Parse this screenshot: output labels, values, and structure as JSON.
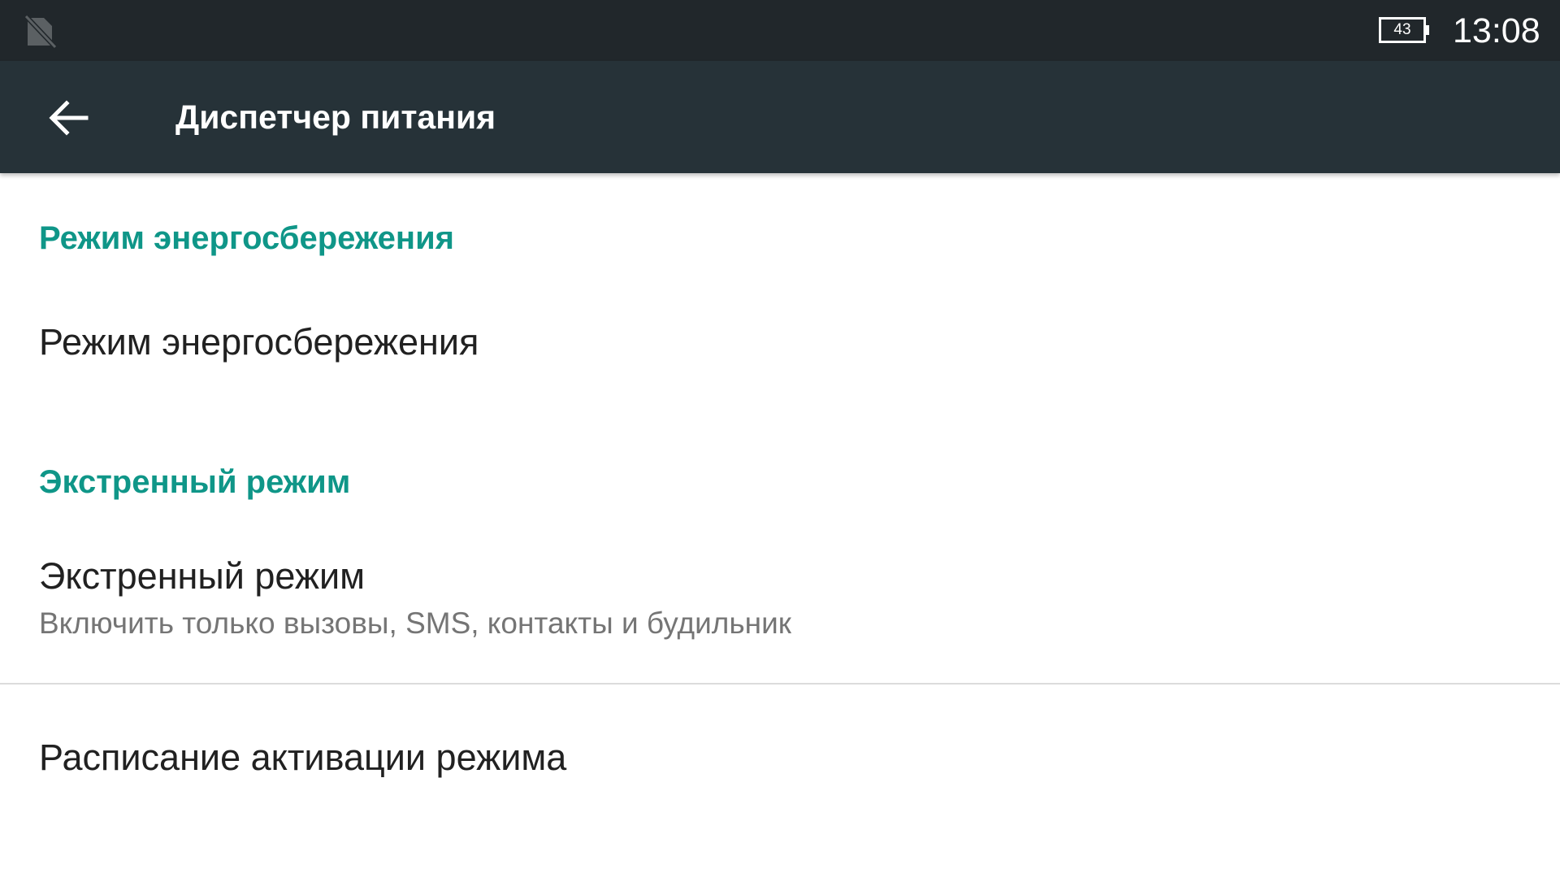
{
  "status_bar": {
    "sim_icon": "no-sim-icon",
    "battery_icon": "battery-icon",
    "battery_level": "43",
    "time": "13:08"
  },
  "app_bar": {
    "back_icon": "arrow-back-icon",
    "title": "Диспетчер питания"
  },
  "sections": [
    {
      "header": "Режим энергосбережения",
      "items": [
        {
          "title": "Режим энергосбережения"
        }
      ]
    },
    {
      "header": "Экстренный режим",
      "items": [
        {
          "title": "Экстренный режим",
          "summary": "Включить только вызовы, SMS, контакты и будильник"
        },
        {
          "title": "Расписание активации режима"
        }
      ]
    }
  ],
  "colors": {
    "status_bar": "#21272b",
    "app_bar": "#263238",
    "accent": "#0f9688",
    "primary_text": "#212121",
    "secondary_text": "#757575"
  }
}
